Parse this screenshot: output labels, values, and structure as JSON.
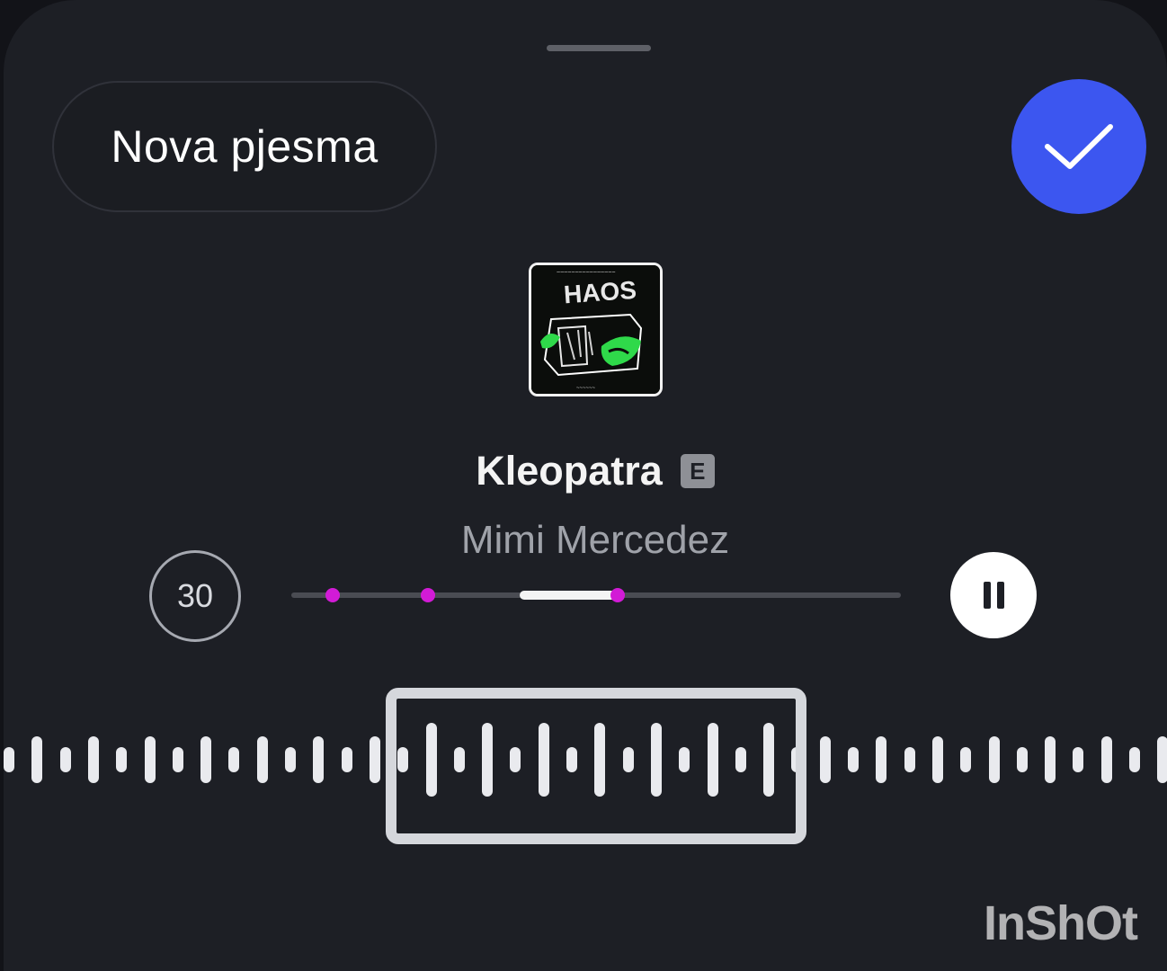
{
  "header": {
    "new_song_label": "Nova pjesma",
    "confirm_icon": "checkmark-icon"
  },
  "track": {
    "title": "Kleopatra",
    "explicit_badge": "E",
    "artist": "Mimi Mercedez",
    "album_art_text": "HAOS"
  },
  "controls": {
    "duration_label": "30",
    "play_state": "paused",
    "pause_icon": "pause-icon"
  },
  "progress": {
    "position_fraction": 0.37
  },
  "watermark": "InShOt",
  "colors": {
    "background": "#1d1f25",
    "accent_blue": "#3c56f0",
    "marker_magenta": "#d21bd6",
    "album_green": "#2fd94a"
  }
}
